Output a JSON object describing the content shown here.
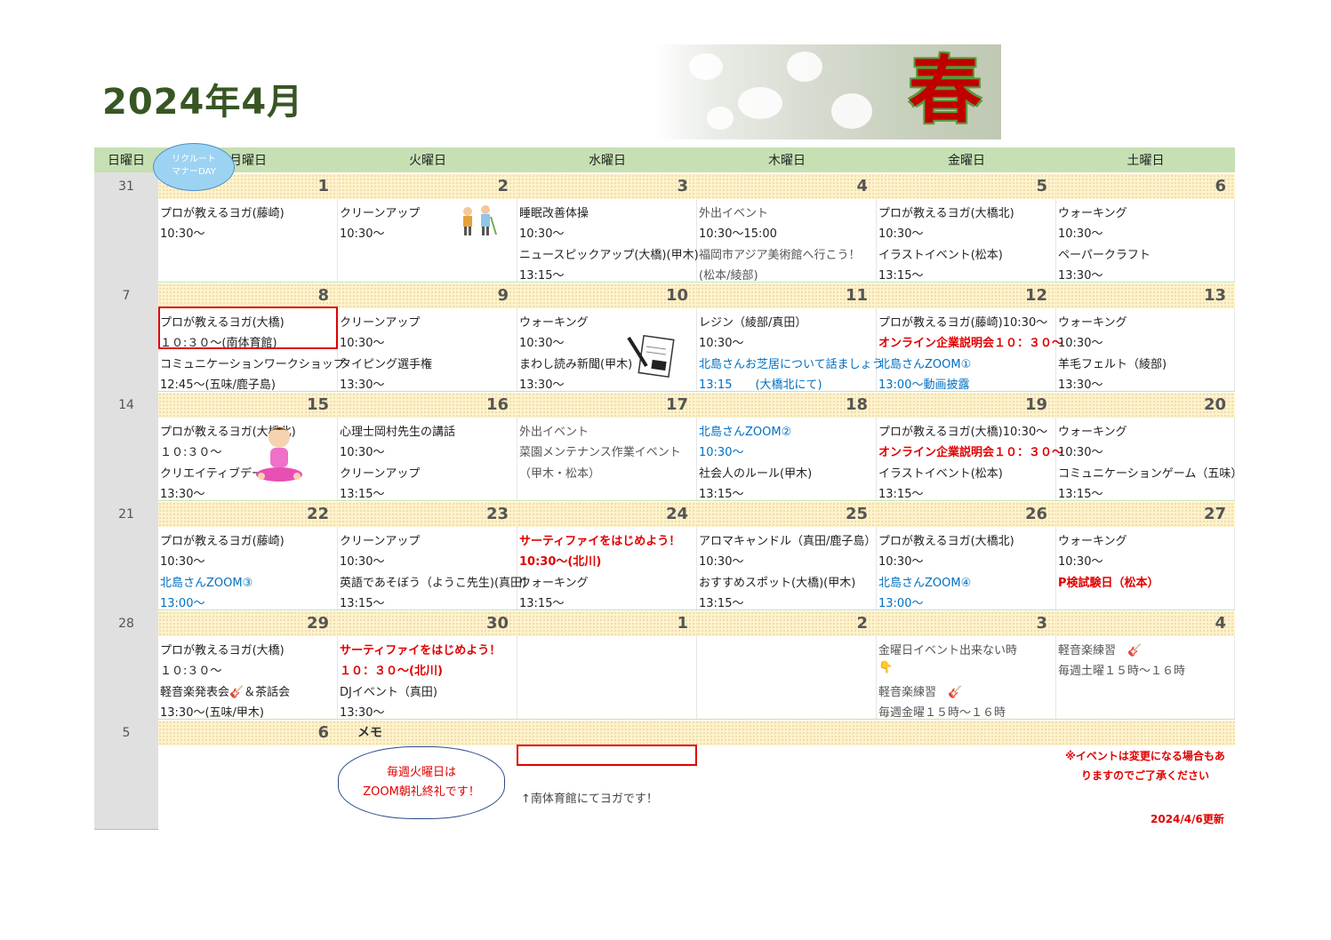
{
  "title": "2024年4月",
  "banner_text": "春",
  "weekday_headers": [
    "日曜日",
    "月曜日",
    "火曜日",
    "水曜日",
    "木曜日",
    "金曜日",
    "土曜日"
  ],
  "bubble_lines": [
    "リクルート",
    "マナーDAY"
  ],
  "weeks": [
    {
      "sunday": "31",
      "days": [
        {
          "num": "1",
          "lines": [
            {
              "t": "プロが教えるヨガ(藤崎)"
            },
            {
              "t": "10:30～"
            }
          ]
        },
        {
          "num": "2",
          "lines": [
            {
              "t": "クリーンアップ"
            },
            {
              "t": "10:30～"
            }
          ]
        },
        {
          "num": "3",
          "lines": [
            {
              "t": "睡眠改善体操"
            },
            {
              "t": "10:30～"
            },
            {
              "t": "ニュースピックアップ(大橋)(甲木)"
            },
            {
              "t": "13:15～"
            }
          ]
        },
        {
          "num": "4",
          "lines": [
            {
              "t": "外出イベント",
              "c": "gray"
            },
            {
              "t": "10:30～15:00"
            },
            {
              "t": "福岡市アジア美術館へ行こう！",
              "c": "gray"
            },
            {
              "t": "(松本/綾部)",
              "c": "gray"
            }
          ]
        },
        {
          "num": "5",
          "lines": [
            {
              "t": "プロが教えるヨガ(大橋北)"
            },
            {
              "t": "10:30～"
            },
            {
              "t": "イラストイベント(松本)"
            },
            {
              "t": "13:15～"
            }
          ]
        },
        {
          "num": "6",
          "lines": [
            {
              "t": "ウォーキング"
            },
            {
              "t": "10:30～"
            },
            {
              "t": "ペーパークラフト"
            },
            {
              "t": "13:30～"
            }
          ]
        }
      ]
    },
    {
      "sunday": "7",
      "days": [
        {
          "num": "8",
          "lines": [
            {
              "t": "プロが教えるヨガ(大橋)"
            },
            {
              "t": "１０:３０～(南体育館)"
            },
            {
              "t": "コミュニケーションワークショップ"
            },
            {
              "t": "12:45～(五味/鹿子島)"
            }
          ]
        },
        {
          "num": "9",
          "lines": [
            {
              "t": "クリーンアップ"
            },
            {
              "t": "10:30～"
            },
            {
              "t": "タイピング選手権"
            },
            {
              "t": "13:30～"
            }
          ]
        },
        {
          "num": "10",
          "lines": [
            {
              "t": "ウォーキング"
            },
            {
              "t": "10:30～"
            },
            {
              "t": "まわし読み新聞(甲木)"
            },
            {
              "t": "13:30～"
            }
          ]
        },
        {
          "num": "11",
          "lines": [
            {
              "t": "レジン（綾部/真田）"
            },
            {
              "t": "10:30～"
            },
            {
              "t": "北島さんお芝居について話ましょう",
              "c": "blue"
            },
            {
              "t": "13:15　　(大橋北にて)",
              "c": "blue"
            }
          ]
        },
        {
          "num": "12",
          "lines": [
            {
              "t": "プロが教えるヨガ(藤崎)10:30～"
            },
            {
              "t": "オンライン企業説明会１０：３０～",
              "c": "red"
            },
            {
              "t": "北島さんZOOM①",
              "c": "blue"
            },
            {
              "t": "13:00～動画披露",
              "c": "blue"
            }
          ]
        },
        {
          "num": "13",
          "lines": [
            {
              "t": "ウォーキング"
            },
            {
              "t": "10:30～"
            },
            {
              "t": "羊毛フェルト（綾部)"
            },
            {
              "t": "13:30～"
            }
          ]
        }
      ]
    },
    {
      "sunday": "14",
      "days": [
        {
          "num": "15",
          "lines": [
            {
              "t": "プロが教えるヨガ(大橋北)"
            },
            {
              "t": "１０:３０～"
            },
            {
              "t": "クリエイティブデー"
            },
            {
              "t": "13:30～"
            }
          ]
        },
        {
          "num": "16",
          "lines": [
            {
              "t": "心理士岡村先生の講話"
            },
            {
              "t": "10:30～"
            },
            {
              "t": "クリーンアップ"
            },
            {
              "t": "13:15～"
            }
          ]
        },
        {
          "num": "17",
          "lines": [
            {
              "t": "外出イベント",
              "c": "gray"
            },
            {
              "t": "菜園メンテナンス作業イベント",
              "c": "gray"
            },
            {
              "t": "（甲木・松本）",
              "c": "gray"
            },
            {
              "t": ""
            }
          ]
        },
        {
          "num": "18",
          "lines": [
            {
              "t": "北島さんZOOM②",
              "c": "blue"
            },
            {
              "t": "10:30～",
              "c": "blue"
            },
            {
              "t": "社会人のルール(甲木)"
            },
            {
              "t": "13:15～"
            }
          ]
        },
        {
          "num": "19",
          "lines": [
            {
              "t": "プロが教えるヨガ(大橋)10:30～"
            },
            {
              "t": "オンライン企業説明会１０：３０～",
              "c": "red"
            },
            {
              "t": "イラストイベント(松本)"
            },
            {
              "t": "13:15～"
            }
          ]
        },
        {
          "num": "20",
          "lines": [
            {
              "t": "ウォーキング"
            },
            {
              "t": "10:30～"
            },
            {
              "t": "コミュニケーションゲーム（五味）"
            },
            {
              "t": "13:15～"
            }
          ]
        }
      ]
    },
    {
      "sunday": "21",
      "days": [
        {
          "num": "22",
          "lines": [
            {
              "t": "プロが教えるヨガ(藤崎)"
            },
            {
              "t": "10:30～"
            },
            {
              "t": "北島さんZOOM③",
              "c": "blue"
            },
            {
              "t": "13:00～",
              "c": "blue"
            }
          ]
        },
        {
          "num": "23",
          "lines": [
            {
              "t": "クリーンアップ"
            },
            {
              "t": "10:30～"
            },
            {
              "t": "英語であそぼう（ようこ先生)(真田)"
            },
            {
              "t": "13:15～"
            }
          ]
        },
        {
          "num": "24",
          "lines": [
            {
              "t": "サーティファイをはじめよう！",
              "c": "red"
            },
            {
              "t": "10:30～(北川)",
              "c": "red"
            },
            {
              "t": "ウォーキング"
            },
            {
              "t": "13:15～"
            }
          ]
        },
        {
          "num": "25",
          "lines": [
            {
              "t": "アロマキャンドル（真田/鹿子島）"
            },
            {
              "t": "10:30～"
            },
            {
              "t": "おすすめスポット(大橋)(甲木)"
            },
            {
              "t": "13:15～"
            }
          ]
        },
        {
          "num": "26",
          "lines": [
            {
              "t": "プロが教えるヨガ(大橋北)"
            },
            {
              "t": "10:30～"
            },
            {
              "t": "北島さんZOOM④",
              "c": "blue"
            },
            {
              "t": "13:00～",
              "c": "blue"
            }
          ]
        },
        {
          "num": "27",
          "lines": [
            {
              "t": "ウォーキング"
            },
            {
              "t": "10:30～"
            },
            {
              "t": "P検試験日（松本）",
              "c": "red"
            },
            {
              "t": ""
            }
          ]
        }
      ]
    },
    {
      "sunday": "28",
      "days": [
        {
          "num": "29",
          "lines": [
            {
              "t": "プロが教えるヨガ(大橋)"
            },
            {
              "t": "１０:３０～"
            },
            {
              "t": "軽音楽発表会🎸＆茶話会"
            },
            {
              "t": "13:30～(五味/甲木)"
            }
          ]
        },
        {
          "num": "30",
          "lines": [
            {
              "t": "サーティファイをはじめよう！",
              "c": "red"
            },
            {
              "t": "１０：３０～(北川)",
              "c": "red"
            },
            {
              "t": "DJイベント（真田)"
            },
            {
              "t": "13:30～"
            }
          ]
        },
        {
          "num": "1",
          "lines": []
        },
        {
          "num": "2",
          "lines": []
        },
        {
          "num": "3",
          "lines": [
            {
              "t": "金曜日イベント出来ない時",
              "c": "gray"
            },
            {
              "t": "👇",
              "c": "gray"
            },
            {
              "t": "軽音楽練習　🎸",
              "c": "gray"
            },
            {
              "t": "毎週金曜１５時～１６時",
              "c": "gray"
            }
          ]
        },
        {
          "num": "4",
          "lines": [
            {
              "t": "軽音楽練習　🎸",
              "c": "gray"
            },
            {
              "t": "毎週土曜１５時～１６時",
              "c": "gray"
            },
            {
              "t": ""
            },
            {
              "t": ""
            }
          ]
        }
      ]
    }
  ],
  "last_row": {
    "sunday": "5",
    "monday_num": "6",
    "memo_label": "メモ"
  },
  "cloud_lines": [
    "毎週火曜日は",
    "ZOOM朝礼終礼です！"
  ],
  "arrow_note": "↑南体育館にてヨガです！",
  "notice_lines": [
    "※イベントは変更になる場合もあ",
    "りますのでご了承ください"
  ],
  "updated": "2024/4/6更新",
  "colors": {
    "header_bg": "#c6e0b4",
    "day_bg": "#fff2cc",
    "sunday_bg": "#e0e0e0",
    "title": "#375623",
    "accent_red": "#e00000",
    "accent_blue": "#0070c0"
  }
}
